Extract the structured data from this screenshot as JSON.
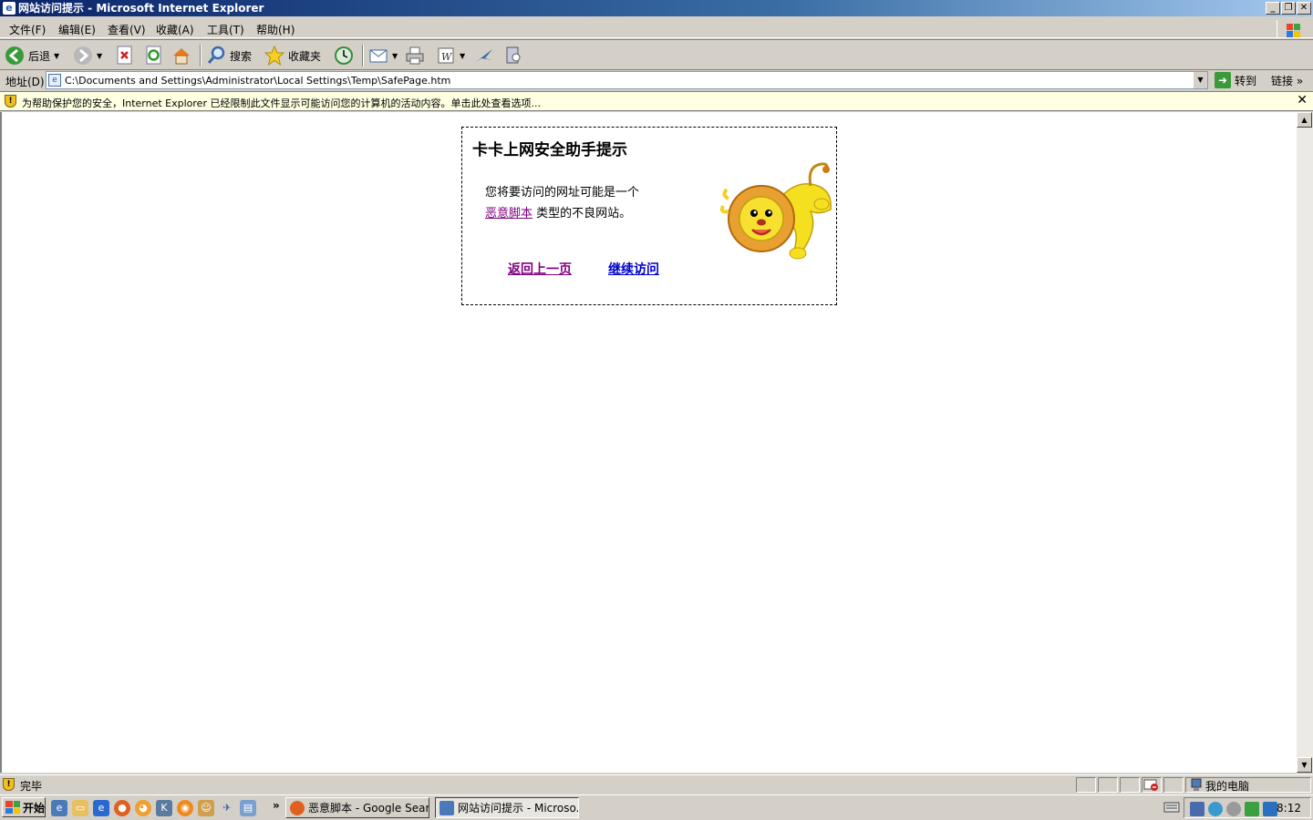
{
  "window": {
    "title": "网站访问提示 - Microsoft Internet Explorer",
    "app_icon": "ie-icon",
    "controls": [
      "minimize",
      "restore",
      "close"
    ]
  },
  "menu": [
    "文件(F)",
    "编辑(E)",
    "查看(V)",
    "收藏(A)",
    "工具(T)",
    "帮助(H)"
  ],
  "toolbar": {
    "back_label": "后退",
    "search_label": "搜索",
    "favorites_label": "收藏夹"
  },
  "address": {
    "label": "地址(D)",
    "value": "C:\\Documents and Settings\\Administrator\\Local Settings\\Temp\\SafePage.htm",
    "go_label": "转到",
    "links_label": "链接"
  },
  "infobar": {
    "text": "为帮助保护您的安全，Internet Explorer 已经限制此文件显示可能访问您的计算机的活动内容。单击此处查看选项..."
  },
  "page": {
    "title": "卡卡上网安全助手提示",
    "line1": "您将要访问的网址可能是一个",
    "threat_link": "恶意脚本",
    "line2_suffix": " 类型的不良网站。",
    "back_link": "返回上一页",
    "continue_link": "继续访问"
  },
  "status": {
    "text": "完毕",
    "zone": "我的电脑"
  },
  "taskbar": {
    "start_label": "开始",
    "tasks": [
      {
        "label": "恶意脚本 - Google Sear..."
      },
      {
        "label": "网站访问提示 - Microso..."
      }
    ],
    "clock": "8:12"
  }
}
